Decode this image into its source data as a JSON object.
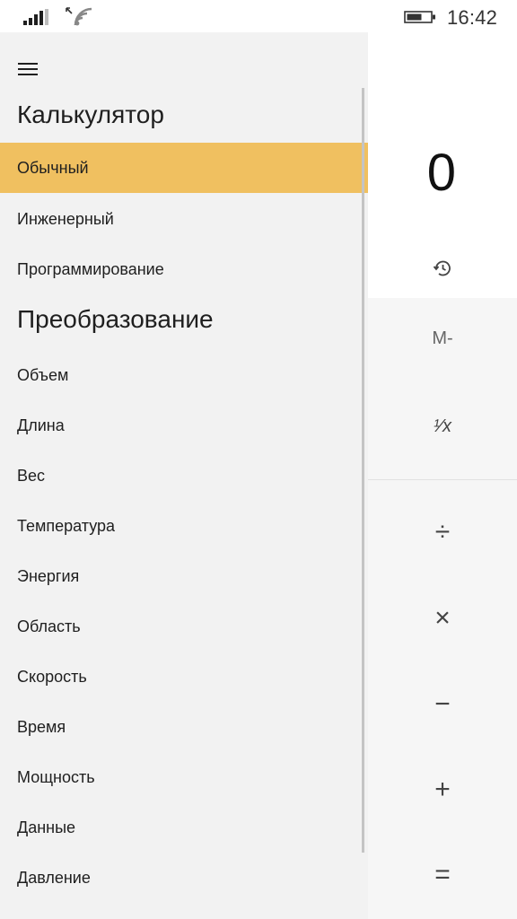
{
  "status_bar": {
    "time": "16:42",
    "signal_icon": "cellular-signal-icon",
    "wifi_icon": "wifi-icon",
    "battery_icon": "battery-icon"
  },
  "nav": {
    "menu_icon": "hamburger-menu-icon",
    "calculator_section_title": "Калькулятор",
    "calculator_items": [
      {
        "label": "Обычный",
        "selected": true
      },
      {
        "label": "Инженерный",
        "selected": false
      },
      {
        "label": "Программирование",
        "selected": false
      }
    ],
    "converter_section_title": "Преобразование",
    "converter_items": [
      {
        "label": "Объем"
      },
      {
        "label": "Длина"
      },
      {
        "label": "Вес"
      },
      {
        "label": "Температура"
      },
      {
        "label": "Энергия"
      },
      {
        "label": "Область"
      },
      {
        "label": "Скорость"
      },
      {
        "label": "Время"
      },
      {
        "label": "Мощность"
      },
      {
        "label": "Данные"
      },
      {
        "label": "Давление"
      }
    ],
    "selected_color": "#f0c060"
  },
  "calculator": {
    "display_value": "0",
    "history_icon": "history-icon",
    "memory_subtract_label": "M-",
    "reciprocal_label": "¹⁄x",
    "divide_label": "÷",
    "multiply_label": "×",
    "subtract_label": "−",
    "add_label": "+",
    "equals_label": "="
  }
}
